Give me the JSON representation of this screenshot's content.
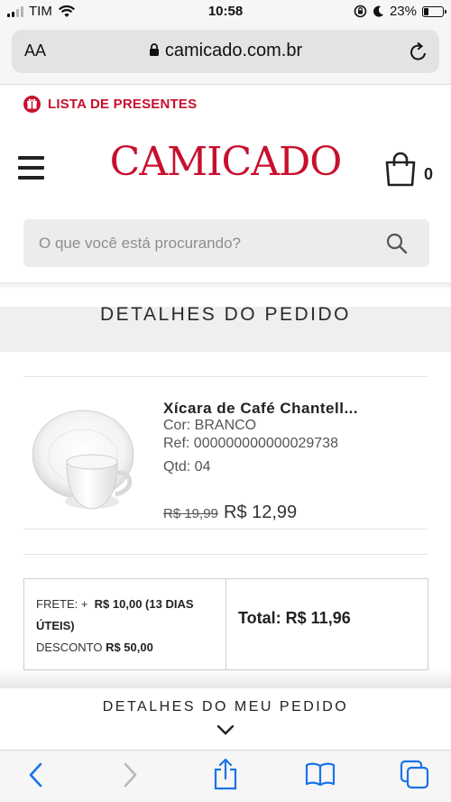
{
  "status_bar": {
    "carrier": "TIM",
    "time": "10:58",
    "battery": "23%",
    "battery_level": 0.23
  },
  "browser": {
    "text_size_label": "AA",
    "url": "camicado.com.br"
  },
  "header": {
    "gift_list_label": "LISTA DE PRESENTES",
    "logo_text": "CAMICADO",
    "cart_count": "0",
    "search_placeholder": "O que você está procurando?",
    "brand_color": "#c8102e"
  },
  "order": {
    "title": "DETALHES DO PEDIDO",
    "item": {
      "name": "Xícara de Café Chantell...",
      "color": "Cor: BRANCO",
      "ref": "Ref: 000000000000029738",
      "qty": "Qtd: 04",
      "old_price": "R$ 19,99",
      "price": "R$ 12,99"
    },
    "summary": {
      "shipping_label": "FRETE: +",
      "shipping_value": "R$ 10,00 (13 DIAS ÚTEIS)",
      "discount_label": "DESCONTO",
      "discount_value": "R$ 50,00",
      "total": "Total: R$ 11,96"
    }
  },
  "drawer": {
    "title": "DETALHES DO MEU PEDIDO"
  },
  "toolbar": {
    "icons": [
      "back-icon",
      "forward-icon",
      "share-icon",
      "bookmarks-icon",
      "tabs-icon"
    ]
  }
}
